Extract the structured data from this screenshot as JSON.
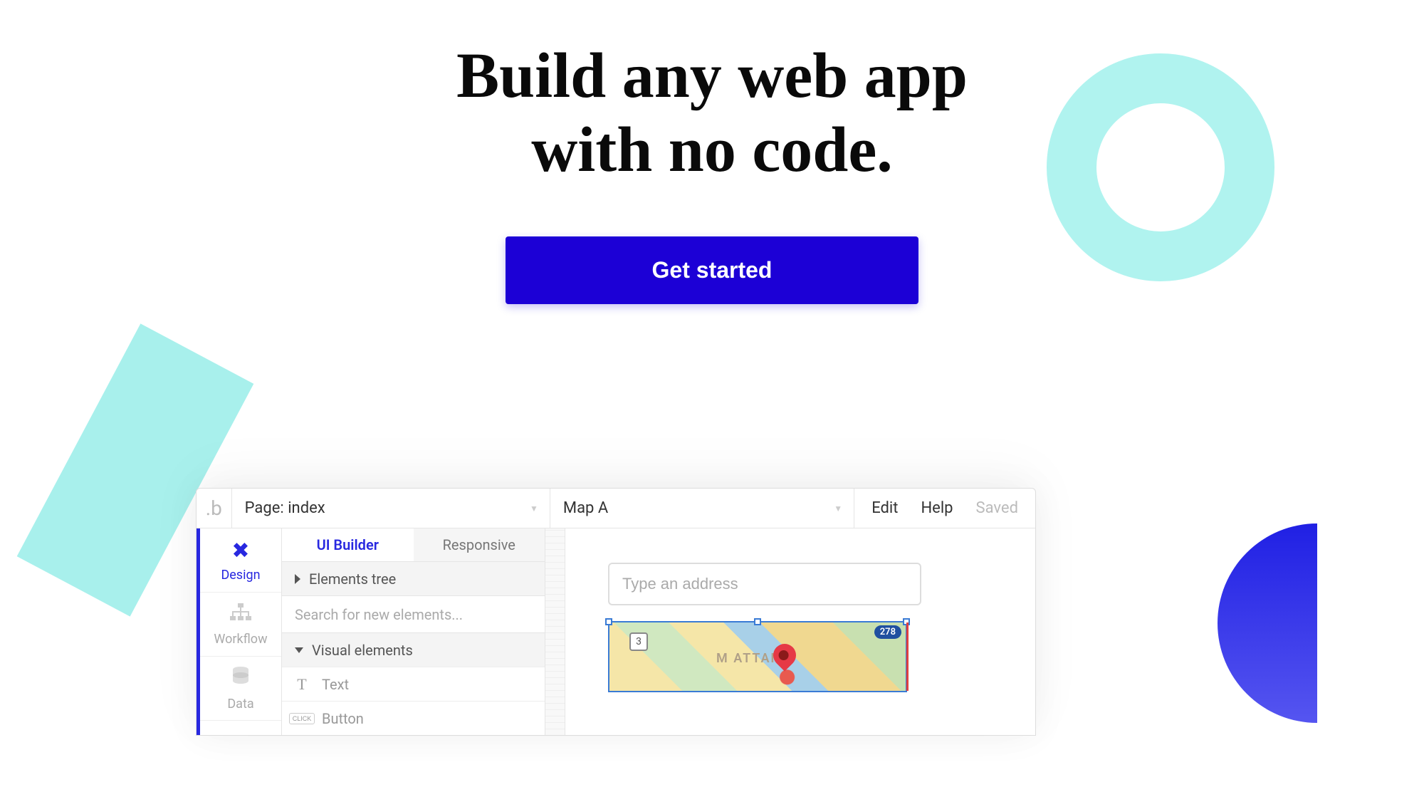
{
  "hero": {
    "title_line1": "Build any web app",
    "title_line2": "with no code.",
    "cta_label": "Get started"
  },
  "editor": {
    "topbar": {
      "page_label": "Page: index",
      "element_label": "Map A",
      "edit_label": "Edit",
      "help_label": "Help",
      "saved_label": "Saved"
    },
    "sidenav": {
      "design": "Design",
      "workflow": "Workflow",
      "data": "Data"
    },
    "panel": {
      "tab_ui": "UI Builder",
      "tab_responsive": "Responsive",
      "elements_tree": "Elements tree",
      "search_placeholder": "Search for new elements...",
      "visual_elements": "Visual elements",
      "item_text": "Text",
      "item_button": "Button"
    },
    "canvas": {
      "address_placeholder": "Type an address",
      "map_city_label": "M     ATTAN",
      "map_route": "278",
      "map_shield": "3"
    }
  }
}
